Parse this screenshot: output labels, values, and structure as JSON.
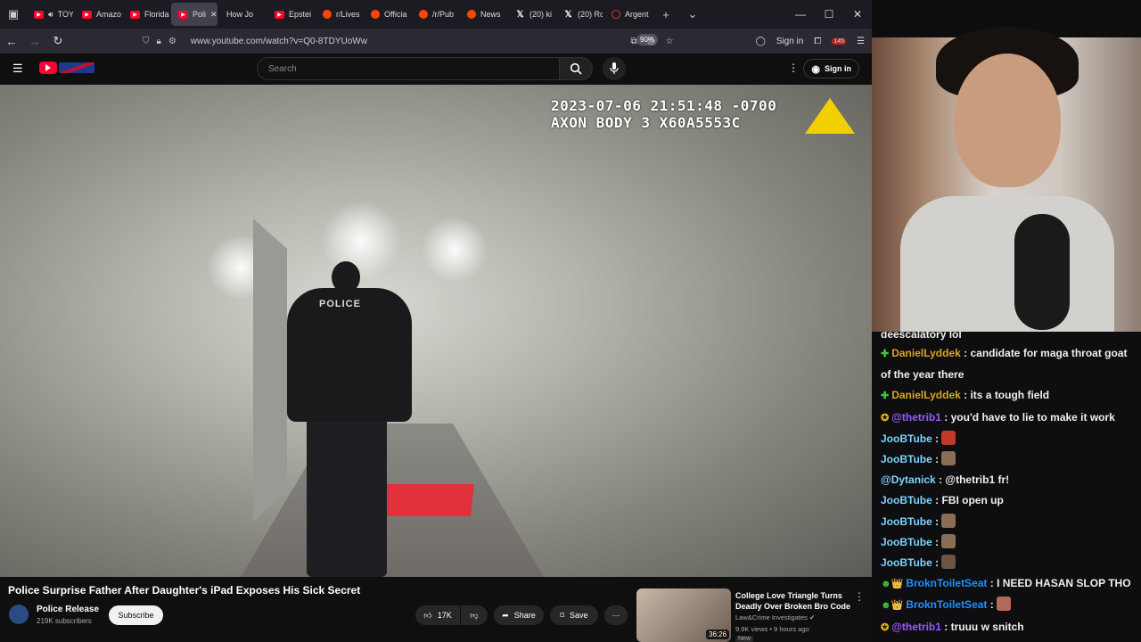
{
  "browser": {
    "tabs": [
      {
        "label": "TOYBO",
        "icon": "yt"
      },
      {
        "label": "Amazo",
        "icon": "yt"
      },
      {
        "label": "Florida",
        "icon": "yt"
      },
      {
        "label": "Poli",
        "icon": "yt",
        "active": true
      },
      {
        "label": "How Jo",
        "icon": "none"
      },
      {
        "label": "Epstei",
        "icon": "yt"
      },
      {
        "label": "r/Lives",
        "icon": "rd"
      },
      {
        "label": "Officia",
        "icon": "rd"
      },
      {
        "label": "/r/Pub",
        "icon": "rd"
      },
      {
        "label": "News",
        "icon": "rd"
      },
      {
        "label": "(20) ki",
        "icon": "x"
      },
      {
        "label": "(20) Ro",
        "icon": "x"
      },
      {
        "label": "Argent",
        "icon": "ar"
      }
    ],
    "url": "www.youtube.com/watch?v=Q0-8TDYUoWw",
    "zoom": "90%",
    "signin": "Sign in",
    "extension_badge": "145"
  },
  "youtube": {
    "search_placeholder": "Search",
    "signin": "Sign in",
    "video": {
      "timestamp": "2023-07-06 21:51:48 -0700",
      "device": "AXON BODY 3 X60A5553C",
      "vest_text": "POLICE",
      "title": "Police Surprise Father After Daughter's iPad Exposes His Sick Secret"
    },
    "channel": {
      "name": "Police Release",
      "subs": "219K subscribers",
      "subscribe": "Subscribe"
    },
    "actions": {
      "likes": "17K",
      "share": "Share",
      "save": "Save"
    },
    "recommended": {
      "title": "College Love Triangle Turns Deadly Over Broken Bro Code",
      "channel": "Law&Crime Investigates",
      "meta": "9.9K views • 9 hours ago",
      "badge": "New",
      "duration": "36:26"
    }
  },
  "chat": {
    "messages": [
      {
        "badge": "",
        "user": "",
        "color": "#efeff1",
        "text": "deescalatory lol"
      },
      {
        "badge": "✚",
        "badge_color": "#3ac73a",
        "user": "DanielLyddek",
        "color": "#daa520",
        "text": "candidate for maga throat goat of the year there"
      },
      {
        "badge": "✚",
        "badge_color": "#3ac73a",
        "user": "DanielLyddek",
        "color": "#daa520",
        "text": "its a tough field"
      },
      {
        "badge": "✪",
        "badge_color": "#e2b400",
        "user": "@thetrib1",
        "color": "#9b59ff",
        "text": "you'd have to lie to make it work"
      },
      {
        "badge": "",
        "user": "JooBTube",
        "color": "#7bd3ff",
        "text": "",
        "emote": "#c0392b"
      },
      {
        "badge": "",
        "user": "JooBTube",
        "color": "#7bd3ff",
        "text": "",
        "emote": "#8a6d55"
      },
      {
        "badge": "",
        "user": "@Dytanick",
        "color": "#7bd3ff",
        "text": "@thetrib1 fr!"
      },
      {
        "badge": "",
        "user": "JooBTube",
        "color": "#7bd3ff",
        "text": "FBI open up"
      },
      {
        "badge": "",
        "user": "JooBTube",
        "color": "#7bd3ff",
        "text": "",
        "emote": "#8a6d55"
      },
      {
        "badge": "",
        "user": "JooBTube",
        "color": "#7bd3ff",
        "text": "",
        "emote": "#8a6d55"
      },
      {
        "badge": "",
        "user": "JooBTube",
        "color": "#7bd3ff",
        "text": "",
        "emote": "#6b5444"
      },
      {
        "badge": "☻👑",
        "badge_color": "#3ac73a",
        "user": "BroknToiletSeat",
        "color": "#1e90ff",
        "text": "I NEED HASAN SLOP THO"
      },
      {
        "badge": "☻👑",
        "badge_color": "#3ac73a",
        "user": "BroknToiletSeat",
        "color": "#1e90ff",
        "text": "",
        "emote": "#b06b5a"
      },
      {
        "badge": "✪",
        "badge_color": "#e2b400",
        "user": "@thetrib1",
        "color": "#9b59ff",
        "text": "truuu w snitch"
      }
    ]
  }
}
